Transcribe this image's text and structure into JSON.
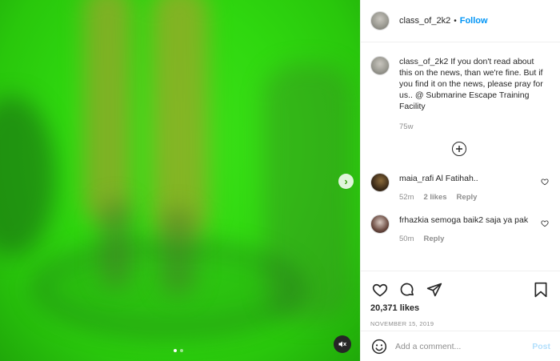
{
  "post": {
    "username": "class_of_2k2",
    "separator": "•",
    "follow_label": "Follow",
    "caption_username": "class_of_2k2",
    "caption_text": " If you don't read about this on the news, than we're fine. But if you find it on the news, please pray for us.. @ Submarine Escape Training Facility",
    "caption_time": "75w",
    "likes": "20,371 likes",
    "date": "NOVEMBER 15, 2019",
    "carousel": {
      "slide_count": 2,
      "active_slide": 1
    }
  },
  "comments": [
    {
      "username": "maia_rafi",
      "text": " Al Fatihah..",
      "time": "52m",
      "likes": "2 likes",
      "reply": "Reply"
    },
    {
      "username": "frhazkia",
      "text": " semoga baik2 saja ya pak",
      "time": "50m",
      "likes": "",
      "reply": "Reply"
    }
  ],
  "comment_box": {
    "placeholder": "Add a comment...",
    "post_label": "Post"
  },
  "colors": {
    "follow_blue": "#0095f6",
    "post_disabled_blue": "#b2dffc",
    "media_green": "#2fd80f"
  },
  "icons": {
    "like": "heart-icon",
    "comment": "comment-icon",
    "share": "paper-plane-icon",
    "save": "bookmark-icon",
    "emoji": "smile-icon",
    "more_comments": "plus-circle-icon",
    "next": "chevron-right-icon",
    "mute": "speaker-muted-icon"
  }
}
